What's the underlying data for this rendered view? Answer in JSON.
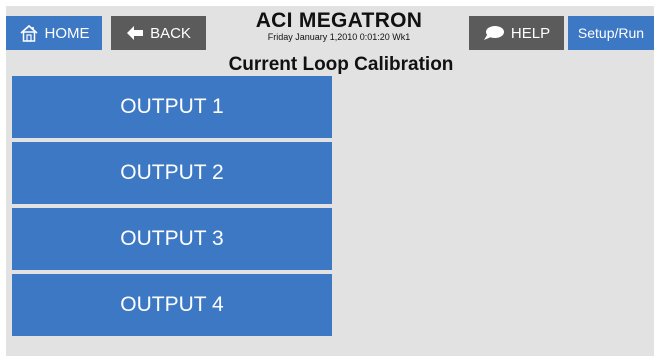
{
  "header": {
    "home_label": "HOME",
    "back_label": "BACK",
    "help_label": "HELP",
    "setup_label": "Setup/Run",
    "title": "ACI MEGATRON",
    "datetime": "Friday January 1,2010 0:01:20 Wk1"
  },
  "page": {
    "subtitle": "Current Loop Calibration"
  },
  "outputs": [
    {
      "label": "OUTPUT 1"
    },
    {
      "label": "OUTPUT 2"
    },
    {
      "label": "OUTPUT 3"
    },
    {
      "label": "OUTPUT 4"
    }
  ],
  "colors": {
    "button_blue": "#3d78c5",
    "button_gray": "#5b5b5b",
    "background": "#e2e2e2"
  },
  "icons": {
    "home": "home-icon",
    "back": "back-arrow-icon",
    "help": "speech-bubble-icon"
  }
}
